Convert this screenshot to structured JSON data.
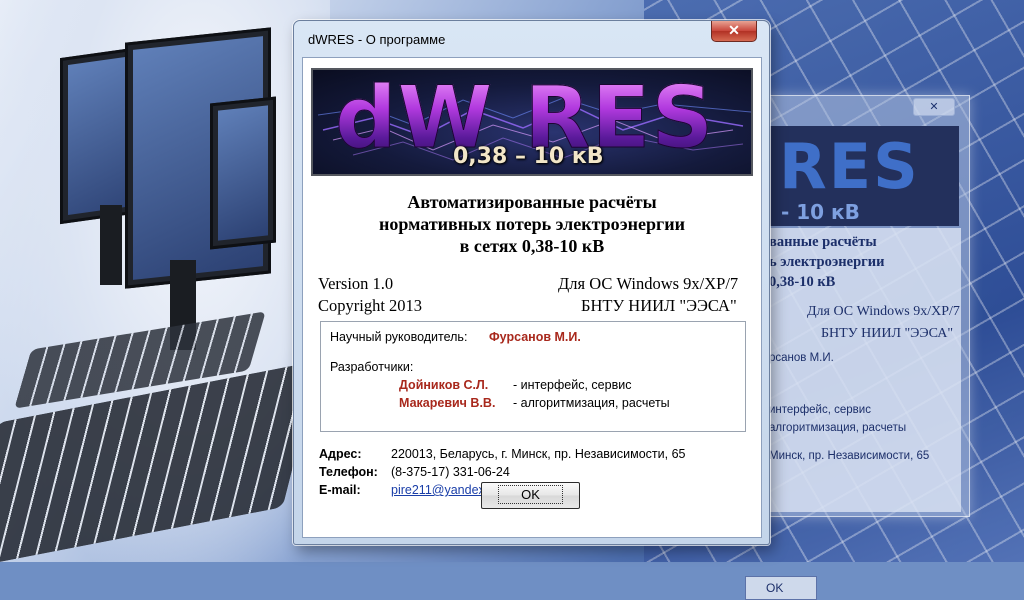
{
  "dialog": {
    "title": "dWRES - О программе",
    "close_glyph": "✕",
    "banner": {
      "logo_text": "dW RES",
      "voltage": "0,38 – 10 кВ"
    },
    "headline": [
      "Автоматизированные расчёты",
      "нормативных потерь электроэнергии",
      "в сетях 0,38-10 кВ"
    ],
    "version": "Version 1.0",
    "os": "Для ОС Windows 9x/XP/7",
    "copyright": "Copyright 2013",
    "org": "БНТУ   НИИЛ \"ЭЭСА\"",
    "supervisor_label": "Научный руководитель:",
    "supervisor_name": "Фурсанов М.И.",
    "developers_label": "Разработчики:",
    "developers": [
      {
        "name": "Дойников С.Л.",
        "role": "- интерфейс, сервис"
      },
      {
        "name": "Макаревич В.В.",
        "role": "- алгоритмизация, расчеты"
      }
    ],
    "contacts": {
      "address_label": "Адрес:",
      "address": "220013, Беларусь, г. Минск, пр. Независимости, 65",
      "phone_label": "Телефон:",
      "phone": "(8-375-17) 331-06-24",
      "email_label": "E-mail:",
      "email": "pire211@yandex.ru"
    },
    "ok_label": "OK"
  },
  "ghost_window": {
    "close_glyph": "✕",
    "logo_text": "RES",
    "voltage": "- 10 кВ",
    "lines": [
      "ванные расчёты",
      "ь электроэнергии",
      "0,38-10 кВ",
      "Для ОС Windows 9x/XP/7",
      "БНТУ   НИИЛ \"ЭЭСА\"",
      "рсанов М.И.",
      "интерфейс, сервис",
      "алгоритмизация, расчеты",
      "Минск, пр. Независимости, 65"
    ],
    "ok_label": "OK"
  }
}
